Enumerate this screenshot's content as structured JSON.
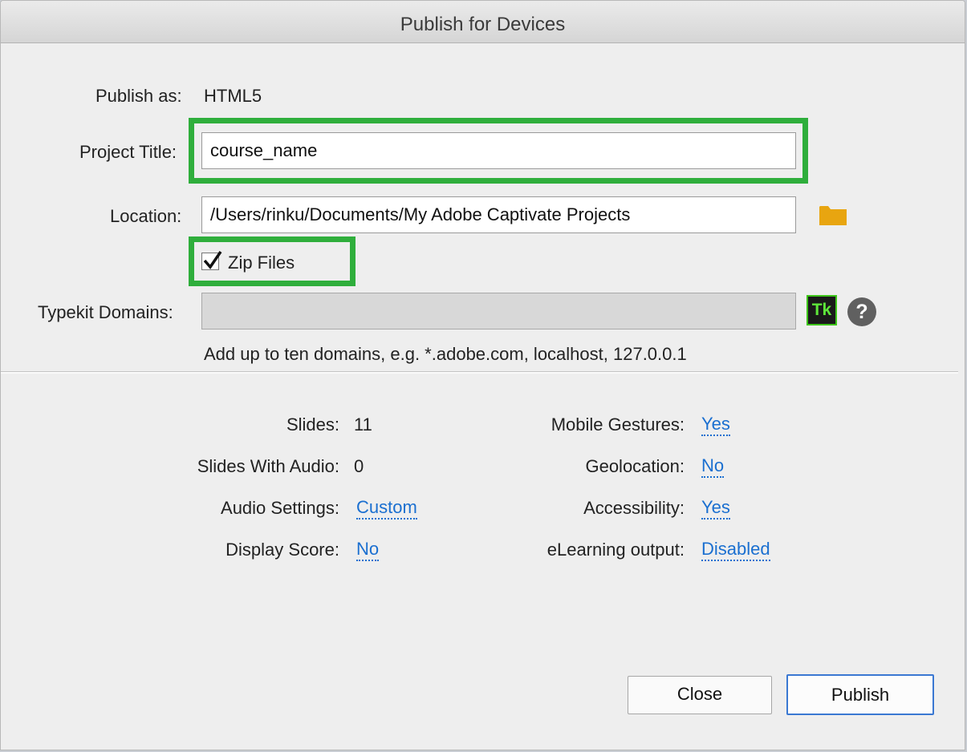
{
  "dialog": {
    "title": "Publish for Devices"
  },
  "publish_as": {
    "label": "Publish as:",
    "value": "HTML5"
  },
  "project_title": {
    "label": "Project Title:",
    "value": "course_name"
  },
  "location": {
    "label": "Location:",
    "value": "/Users/rinku/Documents/My Adobe Captivate Projects"
  },
  "zip_files": {
    "label": "Zip Files",
    "checked": true
  },
  "typekit": {
    "label": "Typekit Domains:",
    "value": "",
    "icon_text": "Tk",
    "help_text": "?",
    "hint": "Add up to ten domains, e.g. *.adobe.com, localhost, 127.0.0.1"
  },
  "stats": {
    "slides": {
      "label": "Slides:",
      "value": "11"
    },
    "slides_with_audio": {
      "label": "Slides With Audio:",
      "value": "0"
    },
    "audio_settings": {
      "label": "Audio Settings:",
      "value": "Custom"
    },
    "display_score": {
      "label": "Display Score:",
      "value": "No"
    },
    "mobile_gestures": {
      "label": "Mobile Gestures:",
      "value": "Yes"
    },
    "geolocation": {
      "label": "Geolocation:",
      "value": "No"
    },
    "accessibility": {
      "label": "Accessibility:",
      "value": "Yes"
    },
    "elearning_output": {
      "label": "eLearning output:",
      "value": "Disabled"
    }
  },
  "buttons": {
    "close": "Close",
    "publish": "Publish"
  },
  "colors": {
    "highlight": "#2fae3c",
    "link": "#1a6fd0",
    "folder": "#e8a510",
    "primary_border": "#3a78d2"
  }
}
